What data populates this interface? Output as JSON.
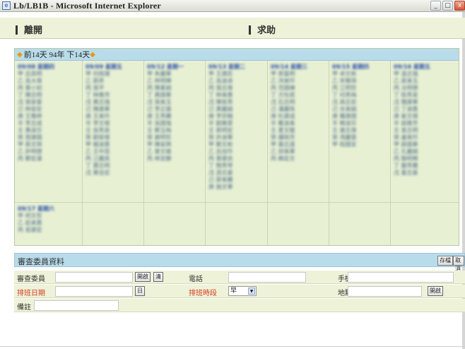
{
  "window": {
    "title": "Lb/LB1B - Microsoft Internet Explorer",
    "buttons": [
      "_",
      "□",
      "x"
    ]
  },
  "menu": {
    "leave_label": "離開",
    "help_label": "求助"
  },
  "calendar": {
    "nav_label": "前14天 94年 下14天",
    "days": [
      {
        "date": "09/08 星期四",
        "items": [
          "甲 呂其明",
          "乙 吳大偉",
          "丙 曾小如",
          "丁 陳志明",
          "戊 張家豪",
          "己 林俊宏",
          "庚 王雅婷",
          "辛 李志成",
          "壬 黃淑芬",
          "癸 周建國",
          "甲 蔡文琪",
          "乙 許明德",
          "丙 鄭宏達"
        ]
      },
      {
        "date": "09/09 星期五",
        "items": [
          "甲 何佩珊",
          "乙 蔡昇",
          "丙 張平",
          "丁 林雅芳",
          "戊 黃志強",
          "己 陳建華",
          "庚 王美玲",
          "辛 李文傑",
          "壬 吳秀英",
          "癸 劉俊傑",
          "甲 楊淑惠",
          "乙 王中昆",
          "丙 江麗英",
          "丁 蕭志明",
          "戊 黃佳宏"
        ]
      },
      {
        "date": "09/12 星期一",
        "items": [
          "甲 朱麗華",
          "乙 林明輝",
          "丙 陳素娟",
          "丁 黃國華",
          "戊 張美玉",
          "己 李正雄",
          "庚 王秀蘭",
          "辛 吳國強",
          "壬 鄭玉梅",
          "癸 謝明哲",
          "甲 陳家興",
          "乙 曾文雄",
          "丙 林宜靜"
        ]
      },
      {
        "date": "09/13 星期二",
        "items": [
          "甲 王建民",
          "乙 吳淑貞",
          "丙 張志偉",
          "丁 林美惠",
          "戊 陳俊男",
          "己 黃麗娟",
          "庚 李宗翰",
          "辛 劉雅雯",
          "壬 蔡明宏",
          "癸 許淑華",
          "甲 鄭文彬",
          "乙 呂佳玲",
          "丙 曾建良",
          "丁 簡秀琴",
          "戊 游志豪",
          "己 廖美蘭",
          "庚 施文華"
        ]
      },
      {
        "date": "09/14 星期三",
        "items": [
          "甲 郭嘉明",
          "乙 洪美玲",
          "丙 范國棟",
          "丁 方怡君",
          "戊 石志明",
          "己 潘麗珠",
          "庚 杜建成",
          "辛 戴淑美",
          "壬 夏文龍",
          "癸 鍾佩芳",
          "甲 葉志遠",
          "乙 邱美華",
          "丙 賴宏文"
        ]
      },
      {
        "date": "09/15 星期四",
        "items": [
          "甲 卓文彬",
          "乙 宋雅琪",
          "丙 江明哲",
          "丁 何秀梅",
          "戊 高志宏",
          "己 余美娟",
          "庚 羅建國",
          "辛 韓淑芬",
          "壬 唐志偉",
          "癸 馮麗雲",
          "甲 程國安"
        ]
      },
      {
        "date": "09/16 星期五",
        "items": [
          "甲 溫志強",
          "乙 蔣美玉",
          "丙 沈明德",
          "丁 陸秀英",
          "戊 魏建華",
          "己 丁淑惠",
          "庚 崔文傑",
          "辛 姚雅芳",
          "壬 袁志明",
          "癸 盧美玲",
          "甲 薛國華",
          "乙 孔麗娟",
          "丙 駱明輝",
          "丁 嚴秀蘭",
          "戊 童志豪"
        ]
      },
      {
        "date": "09/17 星期六",
        "items": [
          "甲 柯文哲",
          "乙 莊美惠",
          "丙 易建宏"
        ]
      }
    ]
  },
  "form": {
    "title": "審查委員資料",
    "save_label": "存檔",
    "cancel_label": "取消",
    "reviewer_label": "審查委員",
    "open_label": "開啟",
    "clear_label": "清",
    "phone_label": "電話",
    "mobile_label": "手機",
    "date_label": "排班日期",
    "calendar_btn_label": "日",
    "period_label": "排班時段",
    "period_value": "早",
    "location_label": "地點",
    "location_open_label": "開啟",
    "note_label": "備註"
  }
}
